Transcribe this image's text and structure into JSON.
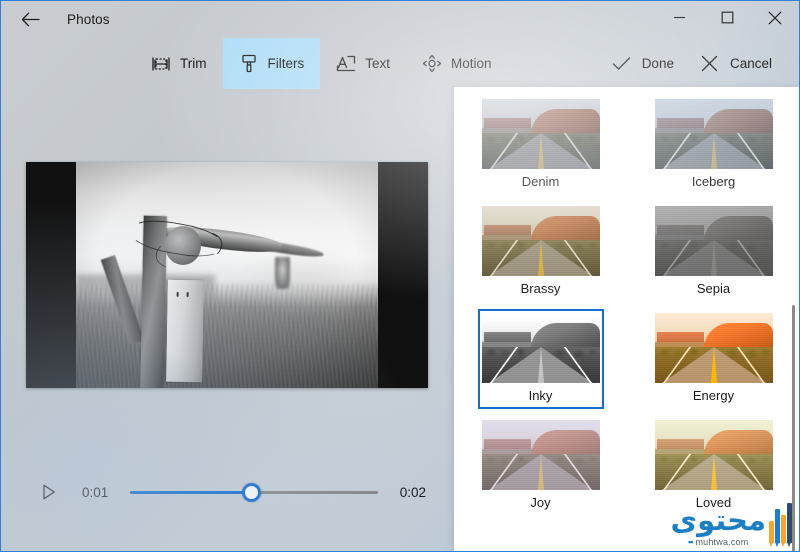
{
  "window": {
    "title": "Photos",
    "back_icon": "back-arrow-icon",
    "minimize_icon": "minimize-icon",
    "maximize_icon": "maximize-icon",
    "close_icon": "close-icon",
    "accent_color": "#2e80d8"
  },
  "toolbar": {
    "tools": [
      {
        "label": "Trim",
        "icon": "trim-icon",
        "selected": false
      },
      {
        "label": "Filters",
        "icon": "filters-brush-icon",
        "selected": true
      },
      {
        "label": "Text",
        "icon": "text-icon",
        "selected": false
      },
      {
        "label": "Motion",
        "icon": "motion-icon",
        "selected": false
      }
    ],
    "actions": [
      {
        "label": "Done",
        "icon": "checkmark-icon"
      },
      {
        "label": "Cancel",
        "icon": "cross-icon"
      }
    ],
    "selected_highlight_color": "#afdcf8"
  },
  "preview": {
    "description": "Black and white video frame of a wooden fence post with barbed wire",
    "letterbox_color": "#111111"
  },
  "playback": {
    "play_icon": "play-icon",
    "current_time": "0:01",
    "total_time": "0:02",
    "progress_percent": 49,
    "fill_color": "#0a69d1",
    "rail_color": "#868686"
  },
  "filters": {
    "selected": "Inky",
    "selection_color": "#1470cc",
    "items": [
      {
        "label": "Denim",
        "tint": "linear-gradient(to bottom, rgba(150,160,185,0.22), rgba(110,125,160,0.28))",
        "saturate": 0.85,
        "brightness": 1.0,
        "contrast": 1.0,
        "grayscale": 0.0
      },
      {
        "label": "Iceberg",
        "tint": "linear-gradient(to bottom, rgba(140,175,215,0.40), rgba(120,150,195,0.30))",
        "saturate": 0.75,
        "brightness": 1.02,
        "contrast": 1.02,
        "grayscale": 0.1
      },
      {
        "label": "Brassy",
        "tint": "linear-gradient(to bottom, rgba(205,170,95,0.26), rgba(150,115,50,0.26))",
        "saturate": 1.05,
        "brightness": 1.02,
        "contrast": 1.05,
        "grayscale": 0.0
      },
      {
        "label": "Sepia",
        "tint": "linear-gradient(to bottom, rgba(120,105,90,0.55), rgba(95,82,68,0.6))",
        "saturate": 0.18,
        "brightness": 1.05,
        "contrast": 1.0,
        "grayscale": 0.8
      },
      {
        "label": "Inky",
        "tint": "linear-gradient(to bottom, rgba(255,255,255,0.0), rgba(0,0,0,0.05))",
        "saturate": 0.0,
        "brightness": 1.06,
        "contrast": 1.25,
        "grayscale": 1.0
      },
      {
        "label": "Energy",
        "tint": "linear-gradient(to bottom, rgba(255,190,110,0.22), rgba(225,140,55,0.24))",
        "saturate": 1.55,
        "brightness": 1.05,
        "contrast": 1.12,
        "grayscale": 0.0
      },
      {
        "label": "Joy",
        "tint": "linear-gradient(to bottom, rgba(215,195,225,0.42), rgba(185,150,175,0.32))",
        "saturate": 0.85,
        "brightness": 1.08,
        "contrast": 0.95,
        "grayscale": 0.0
      },
      {
        "label": "Loved",
        "tint": "linear-gradient(to bottom, rgba(232,225,165,0.40), rgba(215,170,95,0.26))",
        "saturate": 1.25,
        "brightness": 1.06,
        "contrast": 1.05,
        "grayscale": 0.0
      }
    ]
  },
  "watermark": {
    "arabic": "محتوى",
    "domain": "muhtwa.com",
    "color": "#1b7fc4"
  }
}
